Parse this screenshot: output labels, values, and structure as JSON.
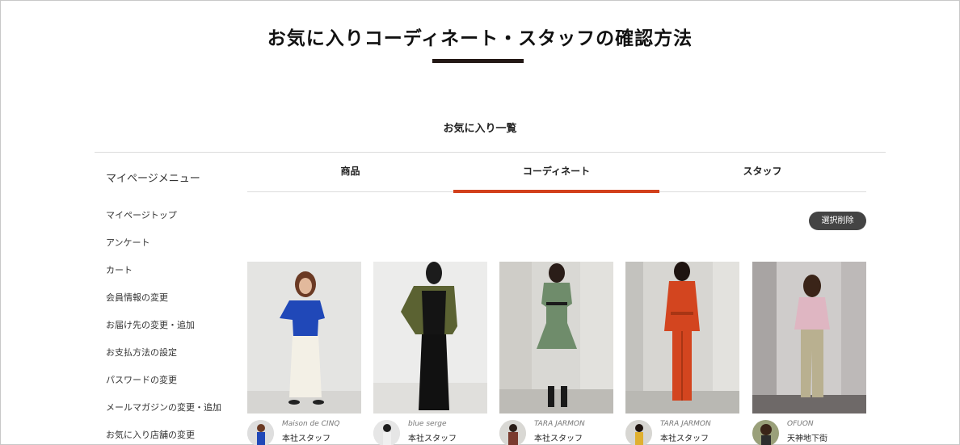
{
  "page": {
    "title": "お気に入りコーディネート・スタッフの確認方法",
    "section_title": "お気に入り一覧"
  },
  "sidebar": {
    "heading": "マイページメニュー",
    "items": [
      {
        "label": "マイページトップ"
      },
      {
        "label": "アンケート"
      },
      {
        "label": "カート"
      },
      {
        "label": "会員情報の変更"
      },
      {
        "label": "お届け先の変更・追加"
      },
      {
        "label": "お支払方法の設定"
      },
      {
        "label": "パスワードの変更"
      },
      {
        "label": "メールマガジンの変更・追加"
      },
      {
        "label": "お気に入り店舗の変更"
      }
    ]
  },
  "tabs": [
    {
      "label": "商品",
      "active": false
    },
    {
      "label": "コーディネート",
      "active": true
    },
    {
      "label": "スタッフ",
      "active": false
    }
  ],
  "actions": {
    "delete_selected": "選択削除"
  },
  "colors": {
    "accent": "#d2401c",
    "title_bar": "#231815",
    "button_bg": "#444444"
  },
  "cards": [
    {
      "brand": "Maison de CINQ",
      "staff": "本社スタッフ"
    },
    {
      "brand": "blue serge",
      "staff": "本社スタッフ"
    },
    {
      "brand": "TARA JARMON",
      "staff": "本社スタッフ"
    },
    {
      "brand": "TARA JARMON",
      "staff": "本社スタッフ"
    },
    {
      "brand": "OFUON",
      "staff": "天神地下街"
    }
  ]
}
